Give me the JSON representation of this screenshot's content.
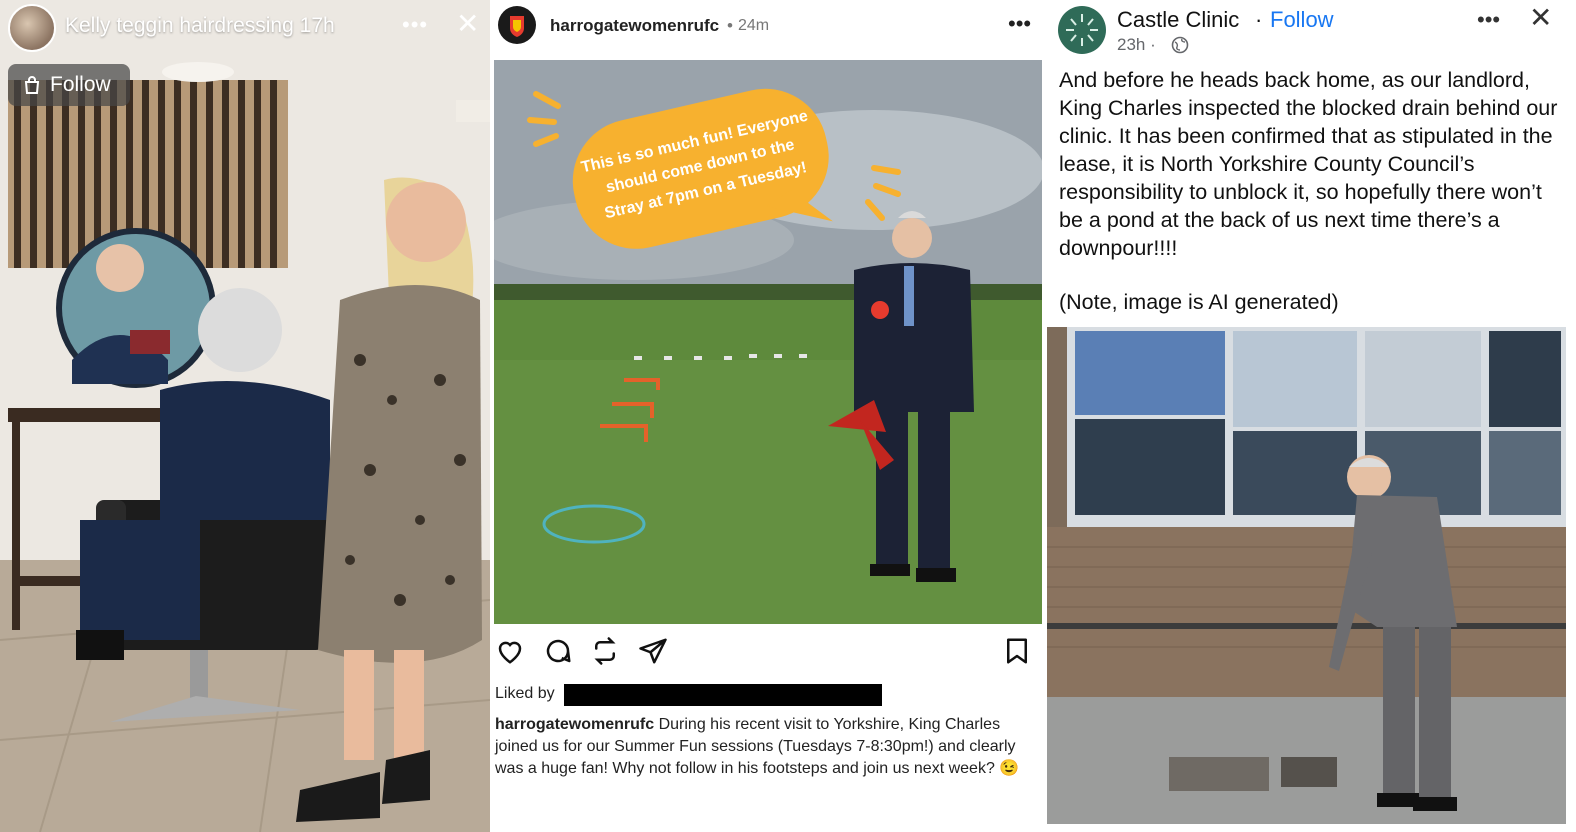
{
  "story": {
    "account_name": "Kelly teggin hairdressing",
    "time": "17h",
    "more_icon": "more-horizontal-icon",
    "close_icon": "close-icon",
    "follow_label": "Follow"
  },
  "instagram": {
    "username": "harrogatewomenrufc",
    "separator": "•",
    "time": "24m",
    "speech_bubble_text": "This is so much fun! Everyone should come down to the Stray at 7pm on a Tuesday!",
    "liked_by_label": "Liked by",
    "caption_user": "harrogatewomenrufc",
    "caption_text": " During his recent visit to Yorkshire, King Charles joined us for our Summer Fun sessions (Tuesdays 7-8:30pm!) and clearly was a huge fan! Why not follow in his footsteps and join us next week? 😉",
    "icons": [
      "heart-icon",
      "comment-icon",
      "repost-icon",
      "share-icon",
      "bookmark-icon"
    ]
  },
  "facebook": {
    "page_name": "Castle Clinic",
    "separator": "·",
    "follow_label": "Follow",
    "time": "23h ·",
    "post_text": "And before he heads back home, as our landlord, King Charles inspected the blocked drain behind our clinic. It has been confirmed that as stipulated in the lease, it is North Yorkshire County Council’s responsibility to unblock it, so hopefully there won’t be a pond at the back of us next time there’s a downpour!!!!",
    "note": "(Note, image is AI generated)",
    "accent_color": "#1877f2"
  }
}
